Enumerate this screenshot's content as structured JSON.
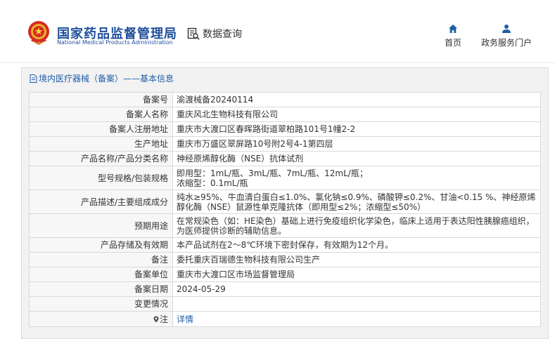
{
  "header": {
    "title_cn": "国家药品监督管理局",
    "title_en": "National Medical Products Administration",
    "data_query": "数据查询",
    "nav": [
      {
        "label": "首页",
        "icon": "home-icon"
      },
      {
        "label": "政务服务门户",
        "icon": "user-icon"
      }
    ]
  },
  "breadcrumb": "境内医疗器械（备案）——基本信息",
  "rows": [
    {
      "label": "备案号",
      "value": "渝渡械备20240114"
    },
    {
      "label": "备案人名称",
      "value": "重庆风北生物科技有限公司"
    },
    {
      "label": "备案人注册地址",
      "value": "重庆市大渡口区春晖路街道翠柏路101号1幢2-2"
    },
    {
      "label": "生产地址",
      "value": "重庆市万盛区翠屏路10号附2号4-1第四层"
    },
    {
      "label": "产品名称/产品分类名称",
      "value": "神经原烯醇化酶（NSE）抗体试剂"
    },
    {
      "label": "型号规格/包装规格",
      "value": "即用型：1mL/瓶、3mL/瓶、7mL/瓶、12mL/瓶；\n浓缩型：0.1mL/瓶"
    },
    {
      "label": "产品描述/主要组成成分",
      "value": "纯水≥95%、牛血清白蛋白≤1.0%、氯化钠≤0.9%、磷酸钾≤0.2%、甘油<0.15 %、神经原烯醇化酶（NSE）鼠源性单克隆抗体（即用型≤2%；浓缩型≤50%）"
    },
    {
      "label": "预期用途",
      "value": "在常规染色（如：HE染色）基础上进行免疫组织化学染色，临床上适用于表达阳性胰腺癌组织，为医师提供诊断的辅助信息。"
    },
    {
      "label": "产品存储及有效期",
      "value": "本产品试剂在2～8℃环境下密封保存，有效期为12个月。"
    },
    {
      "label": "备注",
      "value": "委托重庆百瑞德生物科技有限公司生产"
    },
    {
      "label": "备案单位",
      "value": "重庆市大渡口区市场监督管理局"
    },
    {
      "label": "备案日期",
      "value": "2024-05-29"
    },
    {
      "label": "变更情况",
      "value": ""
    },
    {
      "label": "注",
      "value": "详情"
    }
  ]
}
